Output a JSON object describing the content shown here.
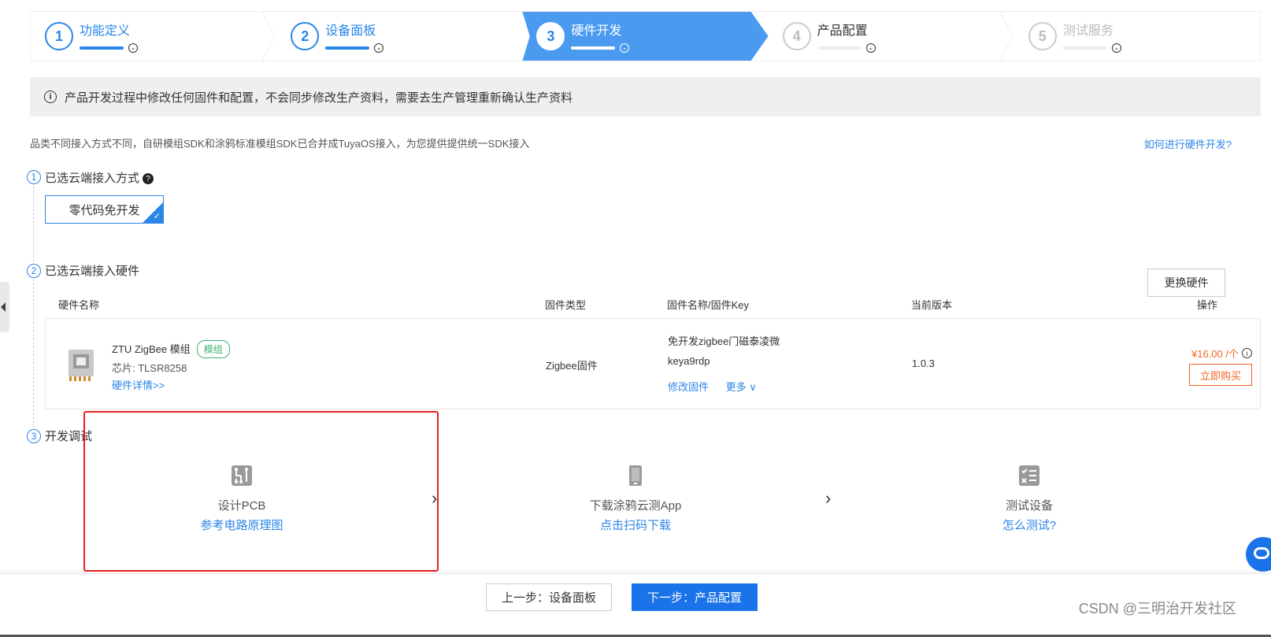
{
  "stepper": {
    "steps": [
      {
        "num": "1",
        "label": "功能定义",
        "state": "done"
      },
      {
        "num": "2",
        "label": "设备面板",
        "state": "done"
      },
      {
        "num": "3",
        "label": "硬件开发",
        "state": "active"
      },
      {
        "num": "4",
        "label": "产品配置",
        "state": "pending"
      },
      {
        "num": "5",
        "label": "测试服务",
        "state": "pending"
      }
    ]
  },
  "notice": {
    "icon": "info-icon",
    "text": "产品开发过程中修改任何固件和配置，不会同步修改生产资料，需要去生产管理重新确认生产资料"
  },
  "subdesc": "品类不同接入方式不同，自研模组SDK和涂鸦标准模组SDK已合并成TuyaOS接入，为您提供提供统一SDK接入",
  "help_link": "如何进行硬件开发?",
  "section1": {
    "num": "1",
    "title": "已选云端接入方式",
    "option": "零代码免开发"
  },
  "section2": {
    "num": "2",
    "title": "已选云端接入硬件",
    "change_button": "更换硬件",
    "headers": {
      "name": "硬件名称",
      "fw_type": "固件类型",
      "fw_name": "固件名称/固件Key",
      "version": "当前版本",
      "action": "操作"
    },
    "row": {
      "name": "ZTU ZigBee 模组",
      "tag": "模组",
      "chip": "芯片: TLSR8258",
      "detail_link": "硬件详情>>",
      "fw_type": "Zigbee固件",
      "fw_name": "免开发zigbee门磁泰凌微",
      "fw_key": "keya9rdp",
      "modify_link": "修改固件",
      "more_link": "更多 ∨",
      "version": "1.0.3",
      "price": "¥16.00 /个",
      "buy_button": "立即购买"
    }
  },
  "section3": {
    "num": "3",
    "title": "开发调试",
    "items": [
      {
        "title": "设计PCB",
        "link": "参考电路原理图",
        "icon": "pcb-icon"
      },
      {
        "title": "下载涂鸦云测App",
        "link": "点击扫码下载",
        "icon": "phone-icon"
      },
      {
        "title": "测试设备",
        "link": "怎么测试?",
        "icon": "checklist-icon"
      }
    ]
  },
  "footer": {
    "prev": "上一步：设备面板",
    "next": "下一步：产品配置",
    "watermark": "CSDN @三明治开发社区"
  },
  "colors": {
    "accent": "#2a86e8",
    "price": "#f26522",
    "highlight_box": "#e52222"
  }
}
